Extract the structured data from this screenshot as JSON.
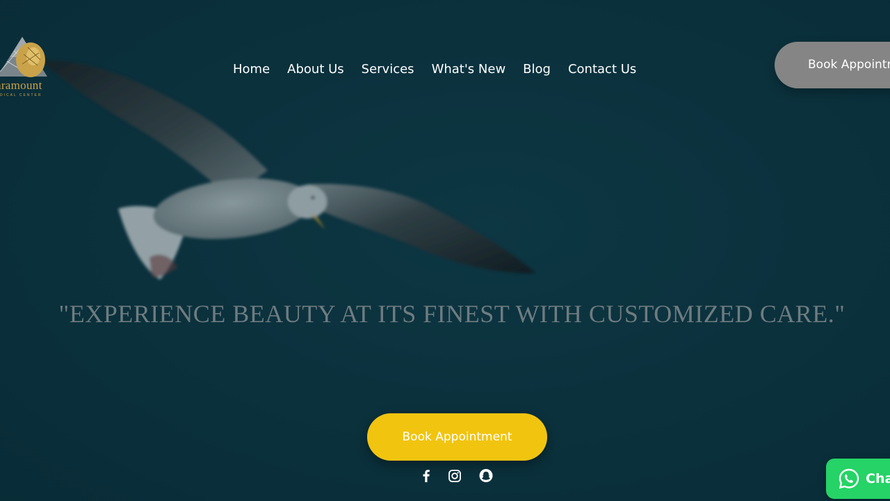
{
  "logo": {
    "wordmark": "aramount",
    "subtitle": "DICAL CENTER"
  },
  "nav": {
    "items": [
      {
        "label": "Home"
      },
      {
        "label": "About Us"
      },
      {
        "label": "Services"
      },
      {
        "label": "What's New"
      },
      {
        "label": "Blog"
      },
      {
        "label": "Contact Us"
      }
    ]
  },
  "header": {
    "cta_label": "Book Appointment"
  },
  "hero": {
    "tagline": "\"EXPERIENCE BEAUTY AT ITS FINEST WITH CUSTOMIZED CARE.\"",
    "cta_label": "Book Appointment",
    "background_icon": "seagull-image"
  },
  "social": {
    "icons": [
      "facebook-icon",
      "instagram-icon",
      "snapchat-icon"
    ]
  },
  "chat": {
    "label": "Chat",
    "icon": "whatsapp-icon"
  },
  "colors": {
    "background": "#0c333e",
    "cta_yellow": "#f1c40f",
    "cta_gray": "#858585",
    "whatsapp_green": "#25d366",
    "logo_gold": "#c9a24a"
  }
}
